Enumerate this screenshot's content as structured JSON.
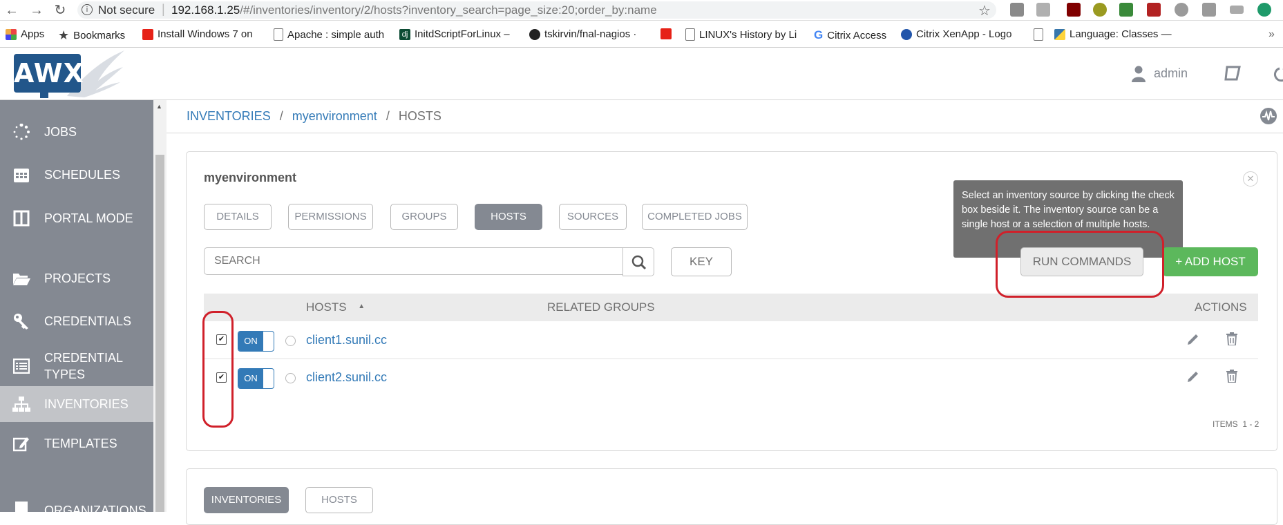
{
  "browser": {
    "security_label": "Not secure",
    "url_host": "192.168.1.25",
    "url_path": "/#/inventories/inventory/2/hosts?inventory_search=page_size:20;order_by:name",
    "bookmarks": [
      {
        "label": "Apps",
        "icon": "apps-grid-icon"
      },
      {
        "label": "Bookmarks",
        "icon": "star-icon"
      },
      {
        "label": "Install Windows 7 on",
        "icon": "youtube-icon"
      },
      {
        "label": "Apache : simple auth",
        "icon": "page-icon"
      },
      {
        "label": "InitdScriptForLinux –",
        "icon": "django-icon"
      },
      {
        "label": "tskirvin/fnal-nagios ·",
        "icon": "github-icon"
      },
      {
        "label": "",
        "icon": "youtube-icon"
      },
      {
        "label": "LINUX's History by Li",
        "icon": "page-icon"
      },
      {
        "label": "Citrix Access",
        "icon": "google-icon"
      },
      {
        "label": "Citrix XenApp - Logo",
        "icon": "citrix-icon"
      },
      {
        "label": "",
        "icon": "page-icon"
      },
      {
        "label": "Language: Classes —",
        "icon": "python-icon"
      }
    ]
  },
  "header": {
    "logo_text": "AWX",
    "user": "admin"
  },
  "sidebar": {
    "items": [
      {
        "label": "JOBS",
        "icon": "spinner-icon"
      },
      {
        "label": "SCHEDULES",
        "icon": "calendar-icon"
      },
      {
        "label": "PORTAL MODE",
        "icon": "columns-icon"
      },
      {
        "label": "PROJECTS",
        "icon": "folder-open-icon"
      },
      {
        "label": "CREDENTIALS",
        "icon": "key-icon"
      },
      {
        "label": "CREDENTIAL",
        "label2": "TYPES",
        "icon": "list-alt-icon"
      },
      {
        "label": "INVENTORIES",
        "icon": "sitemap-icon"
      },
      {
        "label": "TEMPLATES",
        "icon": "edit-icon"
      },
      {
        "label": "ORGANIZATIONS",
        "icon": "building-icon"
      }
    ]
  },
  "breadcrumb": {
    "root": "INVENTORIES",
    "sep": "/",
    "inventory": "myenvironment",
    "current": "HOSTS"
  },
  "panel": {
    "title": "myenvironment",
    "tabs": [
      "DETAILS",
      "PERMISSIONS",
      "GROUPS",
      "HOSTS",
      "SOURCES",
      "COMPLETED JOBS"
    ],
    "active_tab": "HOSTS",
    "search_placeholder": "SEARCH",
    "key_label": "KEY",
    "run_commands_label": "RUN COMMANDS",
    "add_host_label": "+ ADD HOST",
    "tooltip": "Select an inventory source by clicking the check box beside it. The inventory source can be a single host or a selection of multiple hosts.",
    "columns": {
      "hosts": "HOSTS",
      "related_groups": "RELATED GROUPS",
      "actions": "ACTIONS"
    },
    "rows": [
      {
        "checked": true,
        "toggle": "ON",
        "name": "client1.sunil.cc"
      },
      {
        "checked": true,
        "toggle": "ON",
        "name": "client2.sunil.cc"
      }
    ],
    "items_label": "ITEMS",
    "items_range": "1 - 2"
  },
  "lower_panel": {
    "tabs": [
      "INVENTORIES",
      "HOSTS"
    ],
    "active_tab": "INVENTORIES"
  },
  "colors": {
    "sidebar": "#848992",
    "link": "#337ab7",
    "add_button": "#5cb85c",
    "annotation": "#d0202a",
    "tooltip": "#707070"
  }
}
